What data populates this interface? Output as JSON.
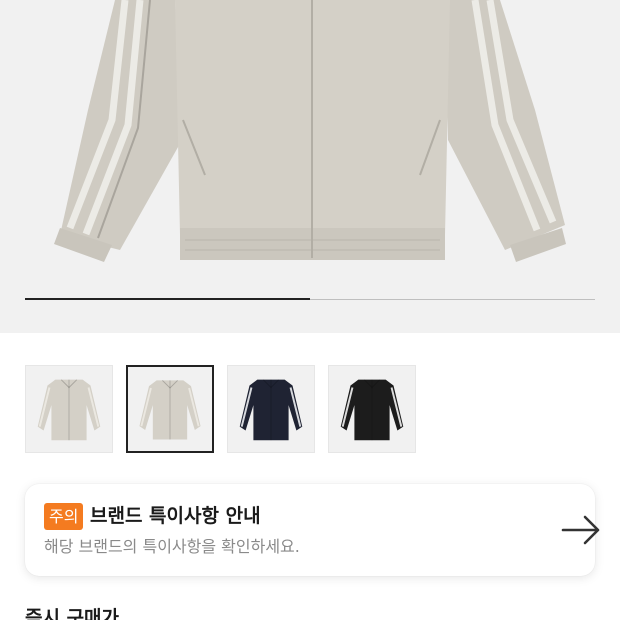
{
  "gallery": {
    "progress_fraction": 0.5,
    "selected_index": 1,
    "thumbnails": [
      {
        "color": "#d4d0c7",
        "stripe": "#ebe8e1"
      },
      {
        "color": "#d4d0c7",
        "stripe": "#ebe8e1"
      },
      {
        "color": "#1f2333",
        "stripe": "#d7d9de"
      },
      {
        "color": "#1c1c1c",
        "stripe": "#dcdcdc"
      }
    ]
  },
  "notice": {
    "badge": "주의",
    "title": "브랜드 특이사항 안내",
    "subtitle": "해당 브랜드의 특이사항을 확인하세요."
  },
  "section": {
    "title": "즉시 구매가"
  },
  "colors": {
    "accent": "#f47b20",
    "jacket": "#d4d0c7"
  }
}
